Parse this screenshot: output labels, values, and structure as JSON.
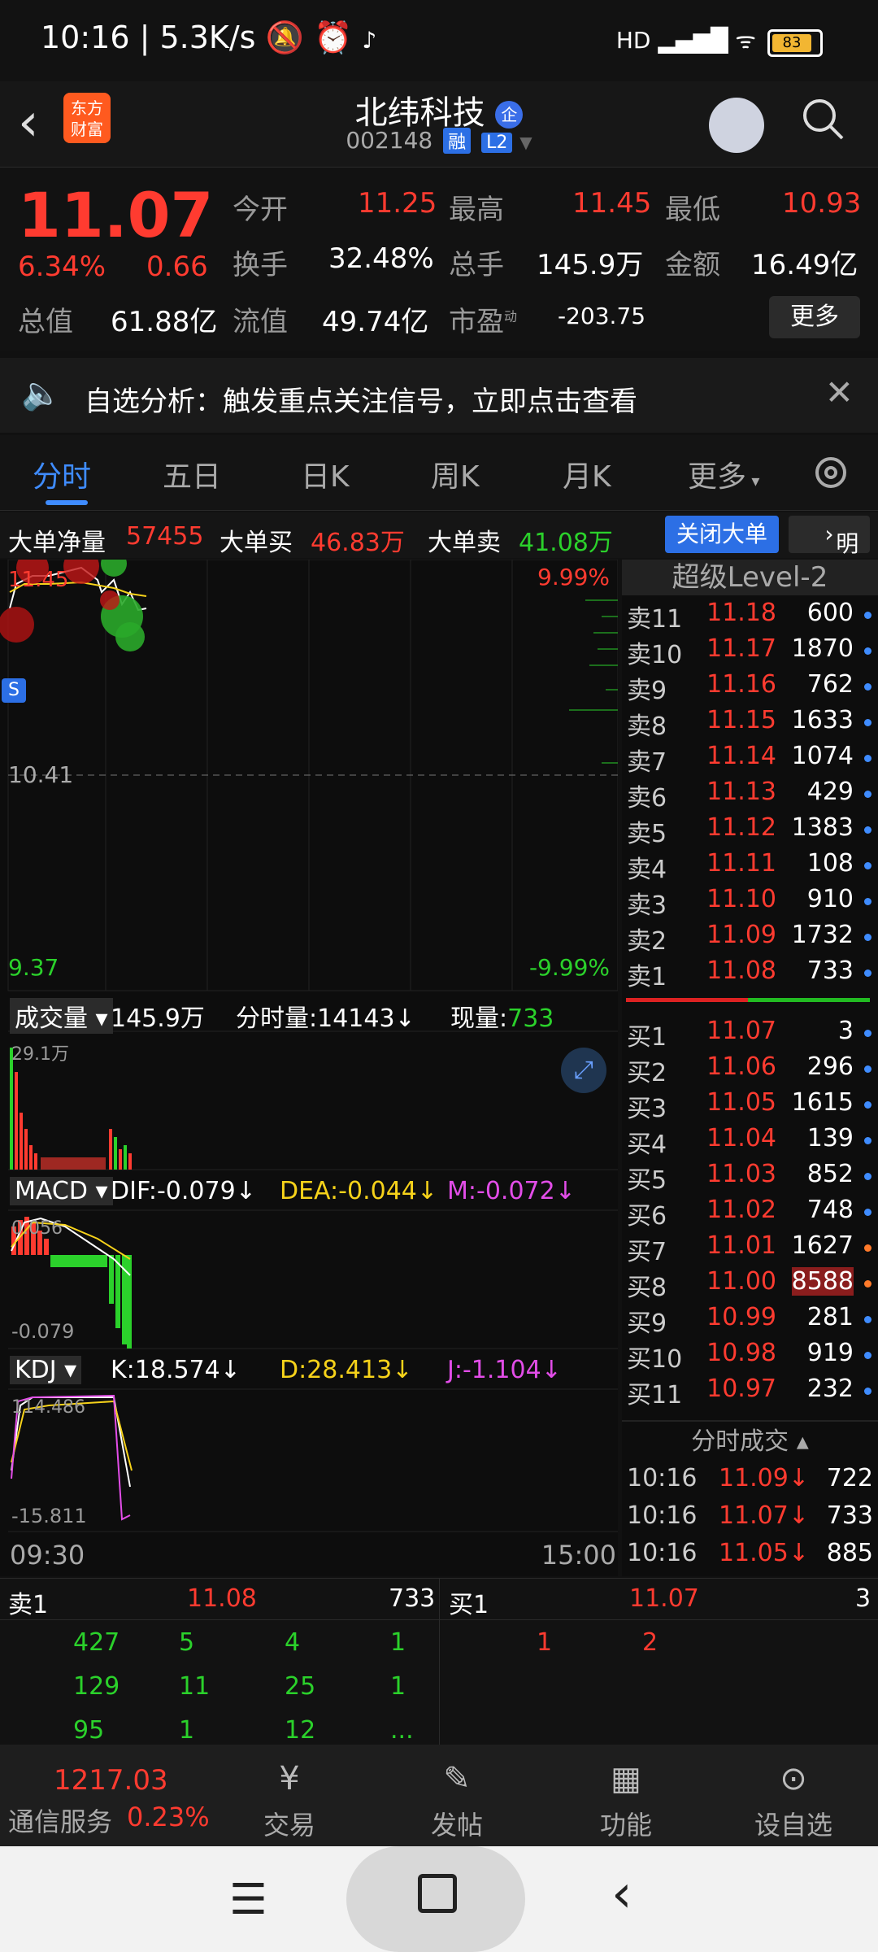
{
  "status_bar": {
    "time": "10:16",
    "speed": "5.3K/s",
    "battery": "83"
  },
  "header": {
    "name": "北纬科技",
    "code": "002148",
    "tag_rong": "融",
    "tag_l2": "L2",
    "logo": "东方财富",
    "badge": "企"
  },
  "quote": {
    "price": "11.07",
    "change_pct": "6.34%",
    "change": "0.66",
    "open_label": "今开",
    "open": "11.25",
    "high_label": "最高",
    "high": "11.45",
    "low_label": "最低",
    "low": "10.93",
    "turnover_label": "换手",
    "turnover": "32.48%",
    "volume_label": "总手",
    "volume": "145.9万",
    "amount_label": "金额",
    "amount": "16.49亿",
    "total_cap_label": "总值",
    "total_cap": "61.88亿",
    "float_cap_label": "流值",
    "float_cap": "49.74亿",
    "pe_label": "市盈",
    "pe_sup": "动",
    "pe": "-203.75",
    "more": "更多"
  },
  "analysis": {
    "text": "自选分析：触发重点关注信号，立即点击查看"
  },
  "tabs": [
    "分时",
    "五日",
    "日K",
    "周K",
    "月K",
    "更多"
  ],
  "big_order": {
    "net_label": "大单净量",
    "net": "57455",
    "buy_label": "大单买",
    "buy": "46.83万",
    "sell_label": "大单卖",
    "sell": "41.08万",
    "close_btn": "关闭大单",
    "detail_btn": "明细"
  },
  "chart": {
    "top_price": "11.45",
    "pct_top": "9.99%",
    "mid_price": "10.41",
    "bottom_price": "9.37",
    "pct_bottom": "-9.99%",
    "volume_label": "成交量",
    "volume_total": "145.9万",
    "minute_vol": "分时量:14143",
    "current_vol_label": "现量:",
    "current_vol": "733",
    "vol_scale": "29.1万",
    "macd_label": "MACD",
    "dif": "DIF:-0.079",
    "dea": "DEA:-0.044",
    "m": "M:-0.072",
    "macd_top": "0.056",
    "macd_bottom": "-0.079",
    "kdj_label": "KDJ",
    "k": "K:18.574",
    "d": "D:28.413",
    "j": "J:-1.104",
    "kdj_top": "114.486",
    "kdj_bottom": "-15.811",
    "time_start": "09:30",
    "time_end": "15:00",
    "marker": "S"
  },
  "book": {
    "title": "超级Level-2",
    "asks": [
      {
        "label": "卖11",
        "price": "11.18",
        "vol": "600"
      },
      {
        "label": "卖10",
        "price": "11.17",
        "vol": "1870"
      },
      {
        "label": "卖9",
        "price": "11.16",
        "vol": "762"
      },
      {
        "label": "卖8",
        "price": "11.15",
        "vol": "1633"
      },
      {
        "label": "卖7",
        "price": "11.14",
        "vol": "1074"
      },
      {
        "label": "卖6",
        "price": "11.13",
        "vol": "429"
      },
      {
        "label": "卖5",
        "price": "11.12",
        "vol": "1383"
      },
      {
        "label": "卖4",
        "price": "11.11",
        "vol": "108"
      },
      {
        "label": "卖3",
        "price": "11.10",
        "vol": "910"
      },
      {
        "label": "卖2",
        "price": "11.09",
        "vol": "1732"
      },
      {
        "label": "卖1",
        "price": "11.08",
        "vol": "733"
      }
    ],
    "bids": [
      {
        "label": "买1",
        "price": "11.07",
        "vol": "3"
      },
      {
        "label": "买2",
        "price": "11.06",
        "vol": "296"
      },
      {
        "label": "买3",
        "price": "11.05",
        "vol": "1615"
      },
      {
        "label": "买4",
        "price": "11.04",
        "vol": "139"
      },
      {
        "label": "买5",
        "price": "11.03",
        "vol": "852"
      },
      {
        "label": "买6",
        "price": "11.02",
        "vol": "748"
      },
      {
        "label": "买7",
        "price": "11.01",
        "vol": "1627"
      },
      {
        "label": "买8",
        "price": "11.00",
        "vol": "8588"
      },
      {
        "label": "买9",
        "price": "10.99",
        "vol": "281"
      },
      {
        "label": "买10",
        "price": "10.98",
        "vol": "919"
      },
      {
        "label": "买11",
        "price": "10.97",
        "vol": "232"
      }
    ],
    "trades_title": "分时成交",
    "trades": [
      {
        "time": "10:16",
        "price": "11.09↓",
        "vol": "722"
      },
      {
        "time": "10:16",
        "price": "11.07↓",
        "vol": "733"
      },
      {
        "time": "10:16",
        "price": "11.05↓",
        "vol": "885"
      }
    ]
  },
  "queue": {
    "sell_label": "卖1",
    "sell_price": "11.08",
    "sell_vol": "733",
    "buy_label": "买1",
    "buy_price": "11.07",
    "buy_vol": "3",
    "sell_rows": [
      [
        "427",
        "5",
        "4",
        "1"
      ],
      [
        "129",
        "11",
        "25",
        "1"
      ],
      [
        "95",
        "1",
        "12",
        "..."
      ]
    ],
    "buy_rows": [
      [
        "1",
        "2"
      ]
    ]
  },
  "nav": {
    "index_value": "1217.03",
    "index_name": "通信服务",
    "index_pct": "0.23%",
    "items": [
      "交易",
      "发帖",
      "功能",
      "设自选"
    ]
  }
}
